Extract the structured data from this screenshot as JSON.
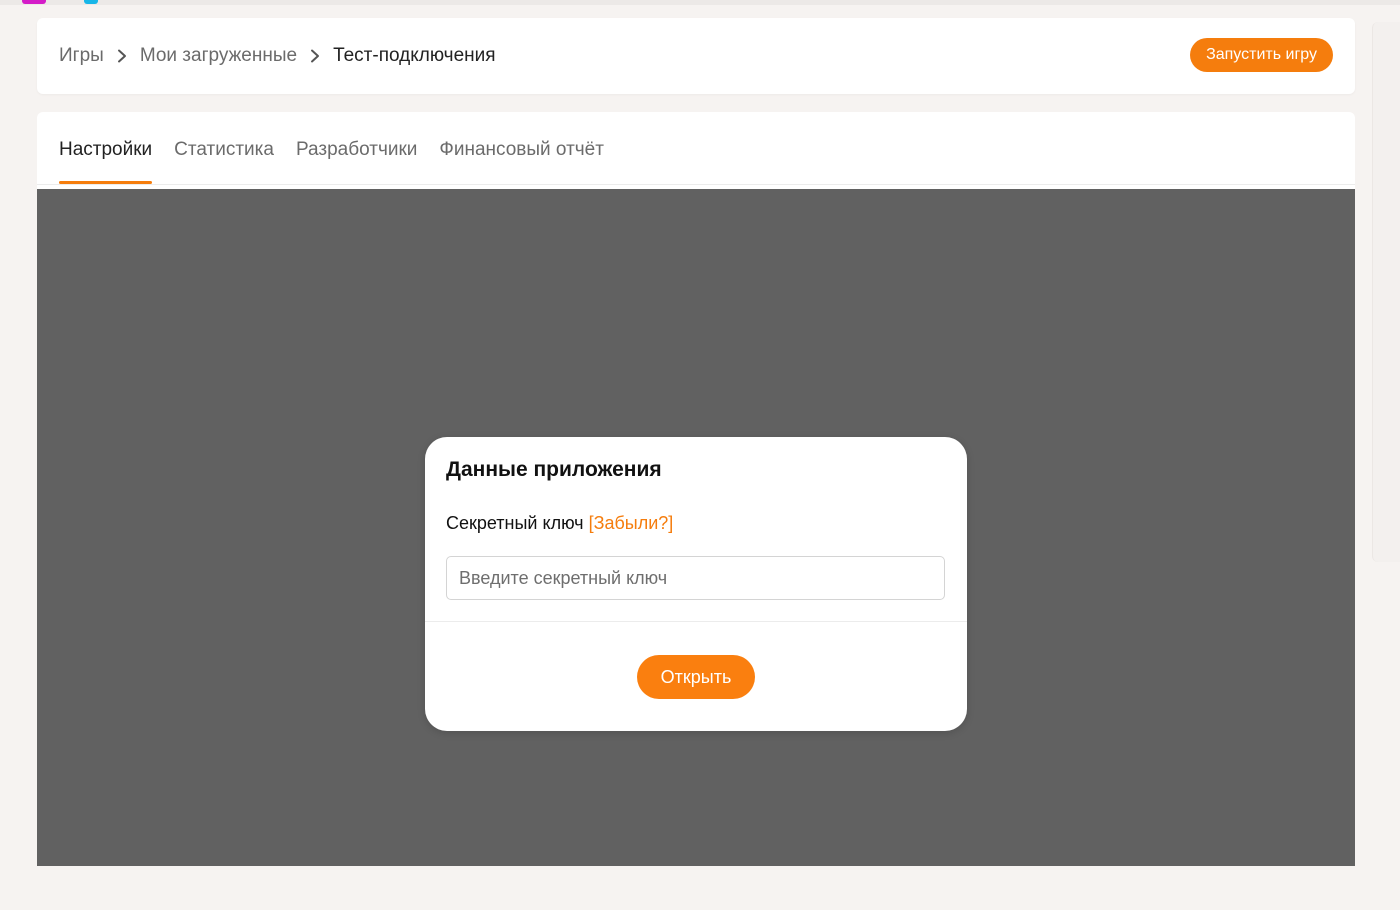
{
  "breadcrumb": {
    "items": [
      "Игры",
      "Мои загруженные",
      "Тест-подключения"
    ]
  },
  "header": {
    "launch_label": "Запустить игру"
  },
  "tabs": [
    {
      "label": "Настройки",
      "active": true
    },
    {
      "label": "Статистика",
      "active": false
    },
    {
      "label": "Разработчики",
      "active": false
    },
    {
      "label": "Финансовый отчёт",
      "active": false
    }
  ],
  "modal": {
    "title": "Данные приложения",
    "field_label": "Секретный ключ",
    "forgot_link": "[Забыли?]",
    "input_placeholder": "Введите секретный ключ",
    "input_value": "",
    "open_label": "Открыть"
  },
  "colors": {
    "accent": "#f57d0d",
    "overlay": "#616161",
    "page_background": "#f6f3f1"
  },
  "icons": {
    "breadcrumb_separator": "chevron-right-icon"
  }
}
